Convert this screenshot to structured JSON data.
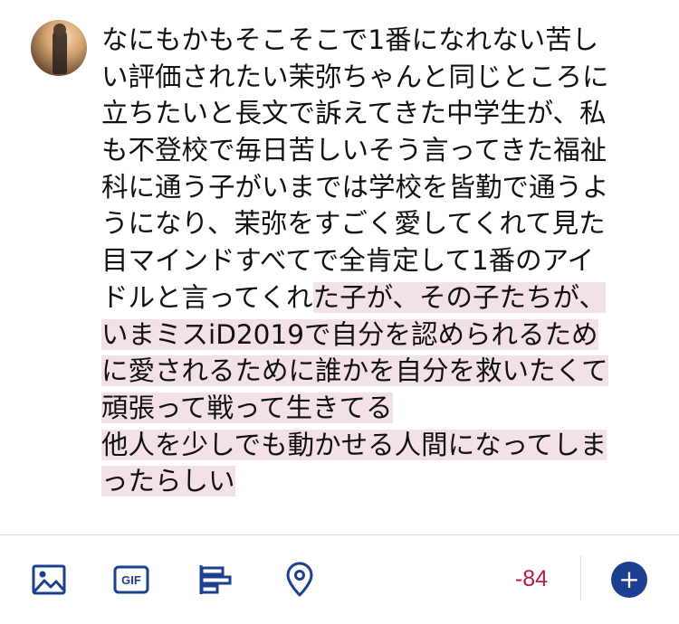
{
  "tweet": {
    "lines": [
      {
        "plain": "なにもかもそこそこで1番になれない苦し",
        "hl": ""
      },
      {
        "plain": "い評価されたい茉弥ちゃんと同じところに",
        "hl": ""
      },
      {
        "plain": "立ちたいと長文で訴えてきた中学生が、私",
        "hl": ""
      },
      {
        "plain": "も不登校で毎日苦しいそう言ってきた福祉",
        "hl": ""
      },
      {
        "plain": "科に通う子がいまでは学校を皆勤で通うよ",
        "hl": ""
      },
      {
        "plain": "うになり、茉弥をすごく愛してくれて見た",
        "hl": ""
      },
      {
        "plain": "目マインドすべてで全肯定して1番のアイ",
        "hl": ""
      },
      {
        "plain": "ドルと言ってくれ",
        "hl": "た子が、その子たちが、"
      },
      {
        "plain": "",
        "hl": "いまミスiD2019で自分を認められるため"
      },
      {
        "plain": "",
        "hl": "に愛されるために誰かを自分を救いたくて"
      },
      {
        "plain": "",
        "hl": "頑張って戦って生きてる"
      },
      {
        "plain": "",
        "hl": "他人を少しでも動かせる人間になってしま"
      },
      {
        "plain": "",
        "hl": "ったらしい"
      }
    ]
  },
  "toolbar": {
    "icons": [
      "image-icon",
      "gif-icon",
      "poll-icon",
      "location-icon"
    ],
    "gif_label": "GIF",
    "char_counter": "-84",
    "add_label": "+"
  },
  "colors": {
    "highlight": "#f3e1e9",
    "counter": "#b01b52",
    "accent": "#1d3f8f"
  }
}
